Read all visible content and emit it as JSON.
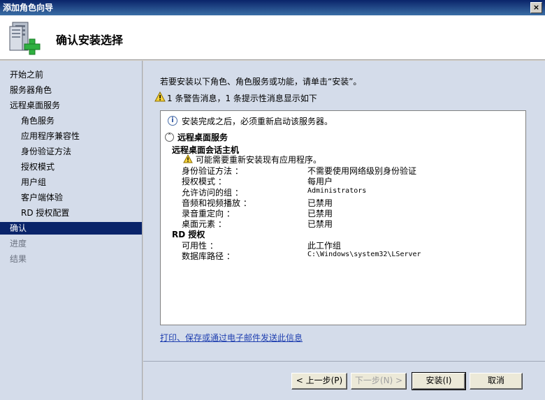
{
  "window": {
    "title": "添加角色向导",
    "close_glyph": "×"
  },
  "header": {
    "title": "确认安装选择"
  },
  "nav": {
    "items": [
      {
        "label": "开始之前",
        "state": "normal"
      },
      {
        "label": "服务器角色",
        "state": "normal"
      },
      {
        "label": "远程桌面服务",
        "state": "normal"
      },
      {
        "label": "角色服务",
        "state": "sub"
      },
      {
        "label": "应用程序兼容性",
        "state": "sub"
      },
      {
        "label": "身份验证方法",
        "state": "sub"
      },
      {
        "label": "授权模式",
        "state": "sub"
      },
      {
        "label": "用户组",
        "state": "sub"
      },
      {
        "label": "客户端体验",
        "state": "sub"
      },
      {
        "label": "RD 授权配置",
        "state": "sub"
      },
      {
        "label": "确认",
        "state": "active"
      },
      {
        "label": "进度",
        "state": "disabled"
      },
      {
        "label": "结果",
        "state": "disabled"
      }
    ]
  },
  "content": {
    "intro": "若要安装以下角色、角色服务或功能，请单击“安装”。",
    "warning_summary": "1 条警告消息，1 条提示性消息显示如下",
    "details": {
      "info": "安装完成之后，必须重新启动该服务器。",
      "section_title": "远程桌面服务",
      "groups": [
        {
          "title": "远程桌面会话主机",
          "note": "可能需要重新安装现有应用程序。",
          "rows": [
            {
              "key": "身份验证方法 ：",
              "value": "不需要使用网络级别身份验证"
            },
            {
              "key": "授权模式 ：",
              "value": "每用户"
            },
            {
              "key": "允许访问的组 ：",
              "value": "Administrators"
            },
            {
              "key": "音频和视频播放 ：",
              "value": "已禁用"
            },
            {
              "key": "录音重定向 ：",
              "value": "已禁用"
            },
            {
              "key": "桌面元素 ：",
              "value": "已禁用"
            }
          ]
        },
        {
          "title": "RD 授权",
          "rows": [
            {
              "key": "可用性 ：",
              "value": "此工作组"
            },
            {
              "key": "数据库路径 ：",
              "value": "C:\\Windows\\system32\\LServer"
            }
          ]
        }
      ]
    },
    "link": "打印、保存或通过电子邮件发送此信息"
  },
  "footer": {
    "prev": "< 上一步(P)",
    "next": "下一步(N) >",
    "install": "安装(I)",
    "cancel": "取消"
  }
}
